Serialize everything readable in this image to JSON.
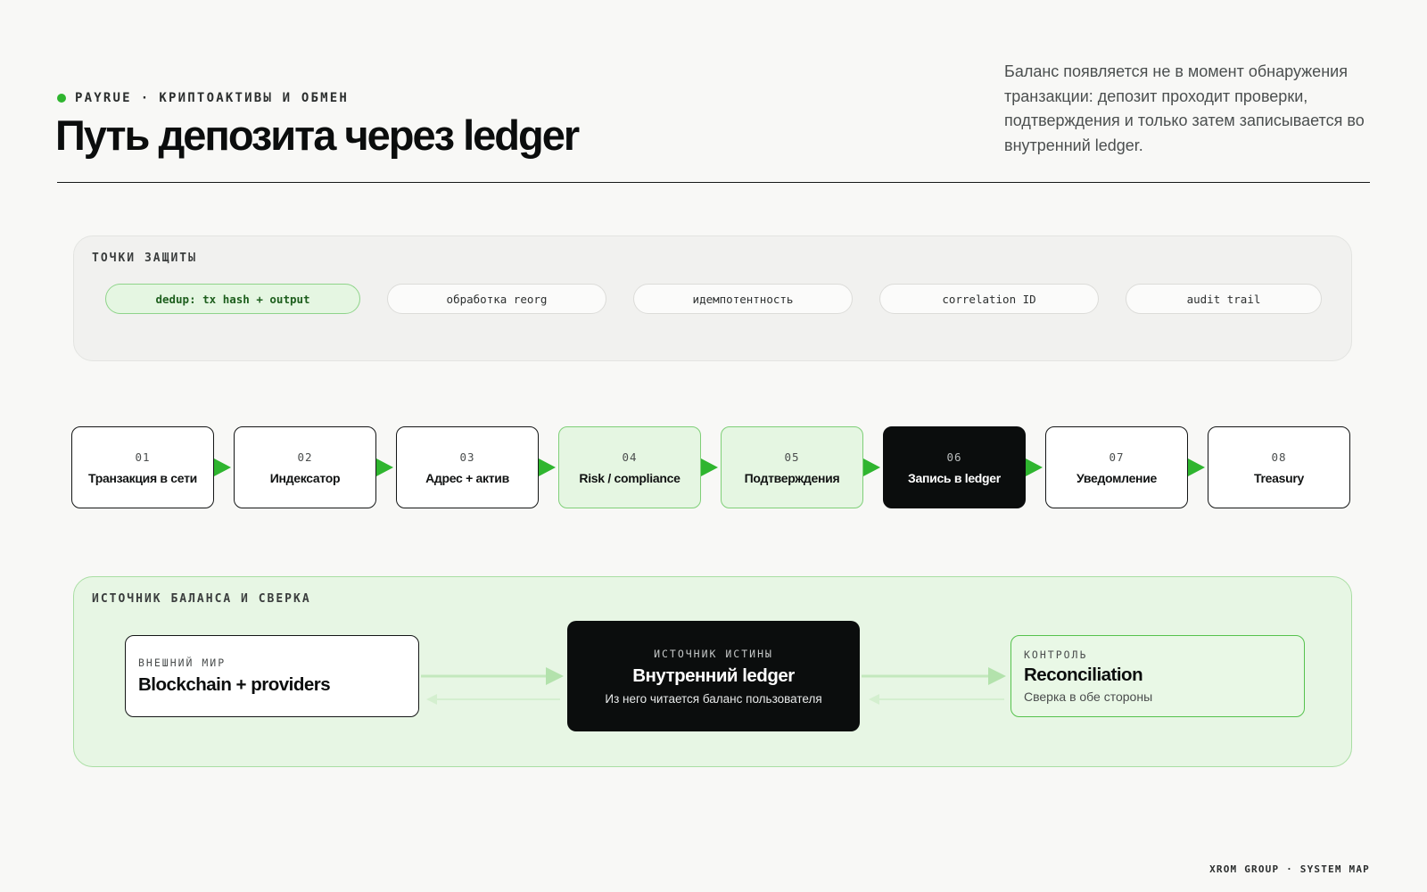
{
  "header": {
    "brand": "PAYRUE",
    "separator": "·",
    "section": "КРИПТОАКТИВЫ И ОБМЕН",
    "title": "Путь депозита через ledger",
    "lede": "Баланс появляется не в момент обнаружения транзакции: депозит проходит проверки, подтверждения и только затем записывается во внутренний ledger."
  },
  "protection": {
    "label": "ТОЧКИ ЗАЩИТЫ",
    "items": [
      {
        "label": "dedup: tx hash + output",
        "active": true
      },
      {
        "label": "обработка reorg",
        "active": false
      },
      {
        "label": "идемпотентность",
        "active": false
      },
      {
        "label": "correlation ID",
        "active": false
      },
      {
        "label": "audit trail",
        "active": false
      }
    ]
  },
  "pipeline": {
    "steps": [
      {
        "num": "01",
        "name": "Транзакция в сети",
        "style": "plain"
      },
      {
        "num": "02",
        "name": "Индексатор",
        "style": "plain"
      },
      {
        "num": "03",
        "name": "Адрес + актив",
        "style": "plain"
      },
      {
        "num": "04",
        "name": "Risk / compliance",
        "style": "soft"
      },
      {
        "num": "05",
        "name": "Подтверждения",
        "style": "soft"
      },
      {
        "num": "06",
        "name": "Запись в ledger",
        "style": "dark"
      },
      {
        "num": "07",
        "name": "Уведомление",
        "style": "plain"
      },
      {
        "num": "08",
        "name": "Treasury",
        "style": "plain"
      }
    ],
    "arrow_color": "#2fb52f"
  },
  "balance": {
    "label": "ИСТОЧНИК БАЛАНСА И СВЕРКА",
    "external": {
      "kicker": "ВНЕШНИЙ МИР",
      "title": "Blockchain + providers"
    },
    "core": {
      "kicker": "ИСТОЧНИК ИСТИНЫ",
      "title": "Внутренний ledger",
      "sub": "Из него читается баланс пользователя"
    },
    "reconciliation": {
      "kicker": "КОНТРОЛЬ",
      "title": "Reconciliation",
      "sub": "Сверка в обе стороны"
    }
  },
  "colors": {
    "accent": "#2fb52f",
    "soft_green": "#e5f6e2",
    "dark": "#0b0d0d"
  },
  "footer": {
    "text": "XROM GROUP · SYSTEM MAP"
  }
}
